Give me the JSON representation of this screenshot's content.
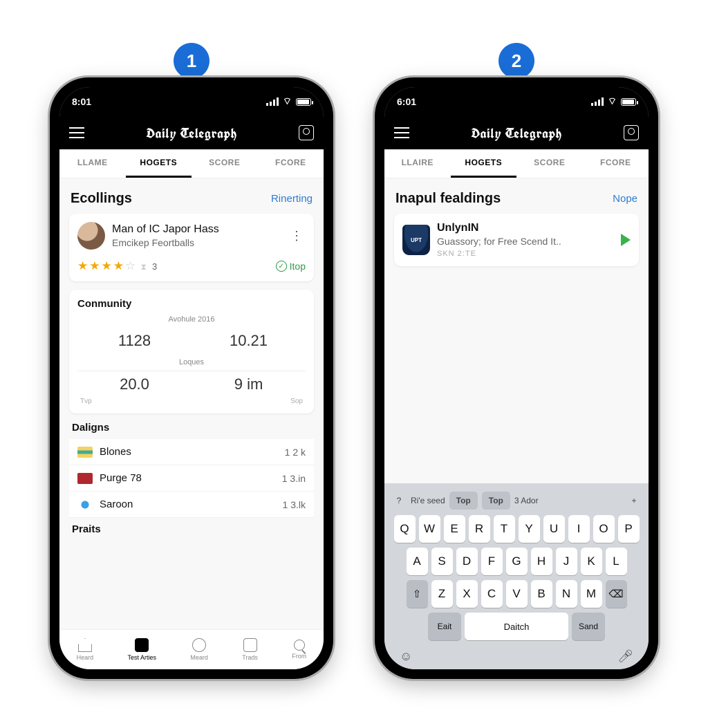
{
  "steps": [
    "1",
    "2"
  ],
  "phone1": {
    "status_time": "8:01",
    "brand": "Daily Telegraph",
    "tabs": [
      "LLAME",
      "HOGETS",
      "SCORE",
      "FCORE"
    ],
    "active_tab_index": 1,
    "section": {
      "title": "Ecollings",
      "action": "Rinerting"
    },
    "story": {
      "title": "Man of IC Japor Hass",
      "subtitle": "Emcikep Feortballs",
      "rating_count": "3",
      "chip": "Itop"
    },
    "community": {
      "heading": "Conmunity",
      "top_label": "Avohule 2016",
      "mid_label": "Loques",
      "cells": [
        "1128",
        "10.21",
        "20.0",
        "9 im"
      ],
      "axis_left": "Tvp",
      "axis_right": "Sop"
    },
    "list_heading": "Daligns",
    "rows": [
      {
        "name": "Blones",
        "value": "1 2 k"
      },
      {
        "name": "Purge 78",
        "value": "1 3.in"
      },
      {
        "name": "Saroon",
        "value": "1 3.lk"
      }
    ],
    "extra_heading": "Praits",
    "tabbar": [
      "Heard",
      "Test Arties",
      "Meard",
      "Trads",
      "From"
    ],
    "tabbar_active": 1
  },
  "phone2": {
    "status_time": "6:01",
    "brand": "Daily Telegraph",
    "tabs": [
      "LLAIRE",
      "HOGETS",
      "SCORE",
      "FCORE"
    ],
    "active_tab_index": 1,
    "section": {
      "title": "Inapul fealdings",
      "action": "Nope"
    },
    "story": {
      "title": "UnlynIN",
      "subtitle": "Guassory; for Free Scend It..",
      "meta": "SKN 2:TE"
    },
    "keyboard": {
      "suggestions": [
        "?",
        "Ri'e seed",
        "Top",
        "Top",
        "3 Ador",
        "+"
      ],
      "row1": [
        "Q",
        "W",
        "E",
        "R",
        "T",
        "Y",
        "U",
        "I",
        "O",
        "P"
      ],
      "row2": [
        "A",
        "S",
        "D",
        "F",
        "G",
        "H",
        "J",
        "K",
        "L"
      ],
      "row3": [
        "Z",
        "X",
        "C",
        "V",
        "B",
        "N",
        "M"
      ],
      "fn_left": "Eait",
      "space": "Daitch",
      "fn_right": "Sand"
    }
  }
}
